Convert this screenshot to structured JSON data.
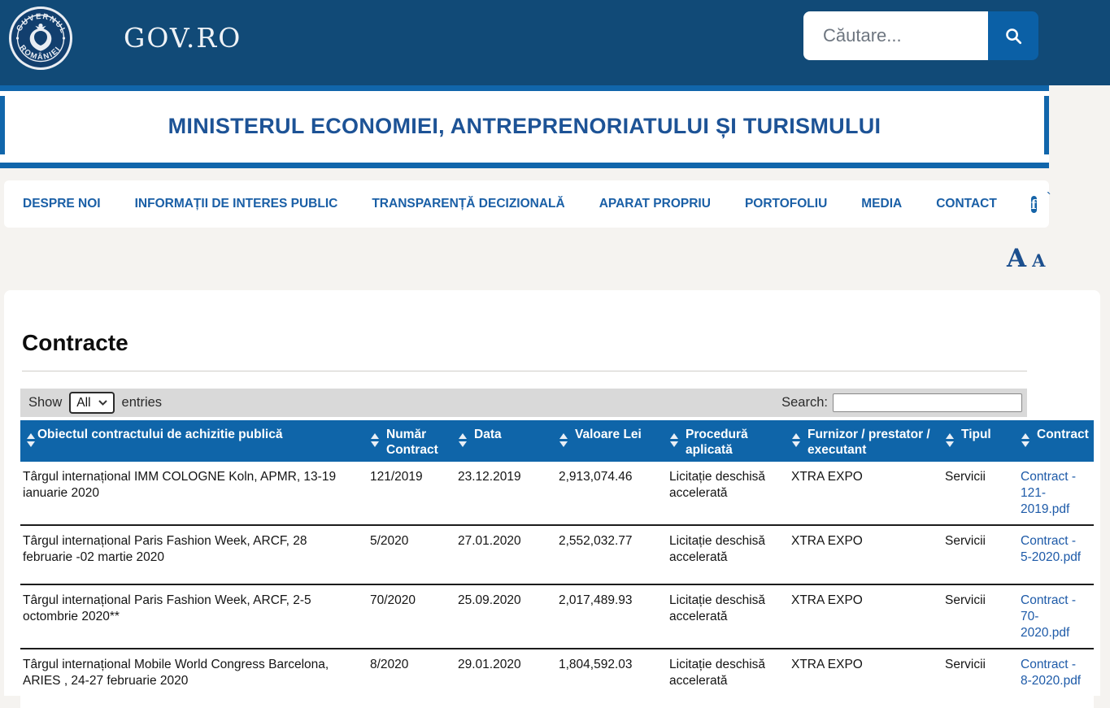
{
  "header": {
    "site_name": "GOV.RO",
    "logo_text_top": "GUVERNUL",
    "logo_text_bottom": "ROMÂNIEI",
    "search_placeholder": "Căutare..."
  },
  "banner": {
    "title": "MINISTERUL ECONOMIEI, ANTREPRENORIATULUI ȘI TURISMULUI"
  },
  "nav": {
    "items": [
      "DESPRE NOI",
      "INFORMAȚII DE INTERES PUBLIC",
      "TRANSPARENȚĂ DECIZIONALĂ",
      "APARAT PROPRIU",
      "PORTOFOLIU",
      "MEDIA",
      "CONTACT"
    ],
    "facebook_icon": "f",
    "facebook_suffix": "`"
  },
  "font_controls": {
    "large_label": "A",
    "small_label": "A"
  },
  "page": {
    "title": "Contracte"
  },
  "table_controls": {
    "show_label": "Show",
    "entries_value": "All",
    "entries_label": "entries",
    "search_label": "Search:",
    "search_value": ""
  },
  "table": {
    "columns": [
      "Obiectul contractului de achizitie publică",
      "Număr Contract",
      "Data",
      "Valoare Lei",
      "Procedură aplicată",
      "Furnizor / prestator / executant",
      "Tipul",
      "Contract"
    ],
    "rows": [
      {
        "obiect": "Târgul internațional IMM COLOGNE Koln, APMR, 13-19 ianuarie 2020",
        "numar": "121/2019",
        "data": "23.12.2019",
        "valoare": "2,913,074.46",
        "procedura": "Licitație deschisă accelerată",
        "furnizor": "XTRA EXPO",
        "tipul": "Servicii",
        "contract": "Contract - 121-2019.pdf"
      },
      {
        "obiect": "Târgul internațional Paris Fashion Week, ARCF, 28 februarie -02 martie 2020",
        "numar": "5/2020",
        "data": "27.01.2020",
        "valoare": "2,552,032.77",
        "procedura": "Licitație deschisă accelerată",
        "furnizor": "XTRA EXPO",
        "tipul": "Servicii",
        "contract": "Contract - 5-2020.pdf"
      },
      {
        "obiect": "Târgul internațional Paris Fashion Week, ARCF, 2-5 octombrie 2020**",
        "numar": "70/2020",
        "data": "25.09.2020",
        "valoare": "2,017,489.93",
        "procedura": "Licitație deschisă accelerată",
        "furnizor": "XTRA EXPO",
        "tipul": "Servicii",
        "contract": "Contract - 70-2020.pdf"
      },
      {
        "obiect": "Târgul internațional Mobile World Congress Barcelona, ARIES , 24-27 februarie 2020",
        "numar": "8/2020",
        "data": "29.01.2020",
        "valoare": "1,804,592.03",
        "procedura": "Licitație deschisă accelerată",
        "furnizor": "XTRA EXPO",
        "tipul": "Servicii",
        "contract": "Contract - 8-2020.pdf"
      }
    ]
  },
  "colors": {
    "header_navy": "#114a77",
    "accent_blue": "#1166ab",
    "table_header_blue": "#0f65a9",
    "link_blue": "#1d5aa8",
    "toolbar_gray": "#d9d9d9",
    "page_background": "#f5f3f0"
  }
}
